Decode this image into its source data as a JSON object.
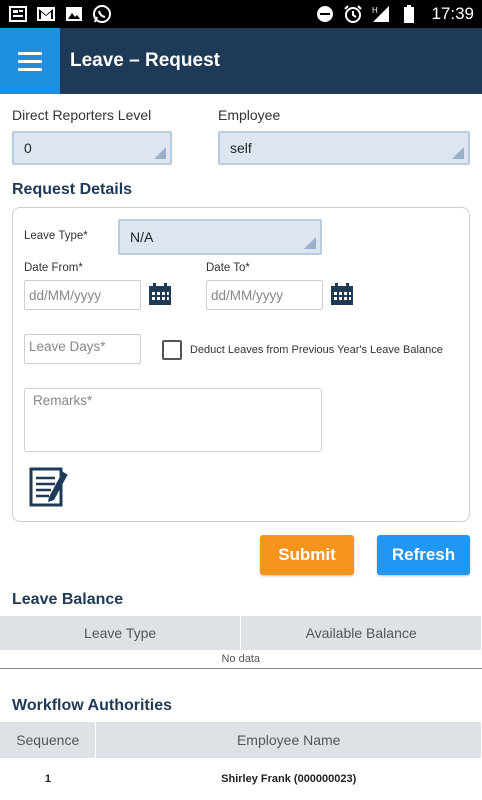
{
  "status_bar": {
    "time": "17:39",
    "left_icons": [
      "news-icon",
      "gmail-icon",
      "image-icon",
      "whatsapp-icon"
    ],
    "right_icons": [
      "dnd-icon",
      "alarm-icon",
      "signal-h-icon",
      "battery-icon"
    ]
  },
  "app_bar": {
    "title": "Leave – Request",
    "menu_icon": "hamburger-icon"
  },
  "filters": {
    "direct_reporters_label": "Direct Reporters Level",
    "direct_reporters_value": "0",
    "employee_label": "Employee",
    "employee_value": "self"
  },
  "request_details": {
    "title": "Request Details",
    "leave_type_label": "Leave Type*",
    "leave_type_value": "N/A",
    "date_from_label": "Date From*",
    "date_from_placeholder": "dd/MM/yyyy",
    "date_to_label": "Date To*",
    "date_to_placeholder": "dd/MM/yyyy",
    "leave_days_placeholder": "Leave Days*",
    "deduct_label": "Deduct Leaves from Previous Year's Leave Balance",
    "remarks_placeholder": "Remarks*"
  },
  "actions": {
    "submit": "Submit",
    "refresh": "Refresh"
  },
  "leave_balance": {
    "title": "Leave Balance",
    "columns": [
      "Leave Type",
      "Available Balance"
    ],
    "empty_text": "No data"
  },
  "workflow": {
    "title": "Workflow Authorities",
    "columns": [
      "Sequence",
      "Employee Name"
    ],
    "rows": [
      {
        "sequence": "1",
        "name": "Shirley Frank (000000023)"
      }
    ]
  },
  "colors": {
    "app_bar": "#1f3a56",
    "menu_button": "#1e8fe0",
    "submit": "#f7941d",
    "refresh": "#2196f3",
    "select_bg": "#dde6f0"
  }
}
